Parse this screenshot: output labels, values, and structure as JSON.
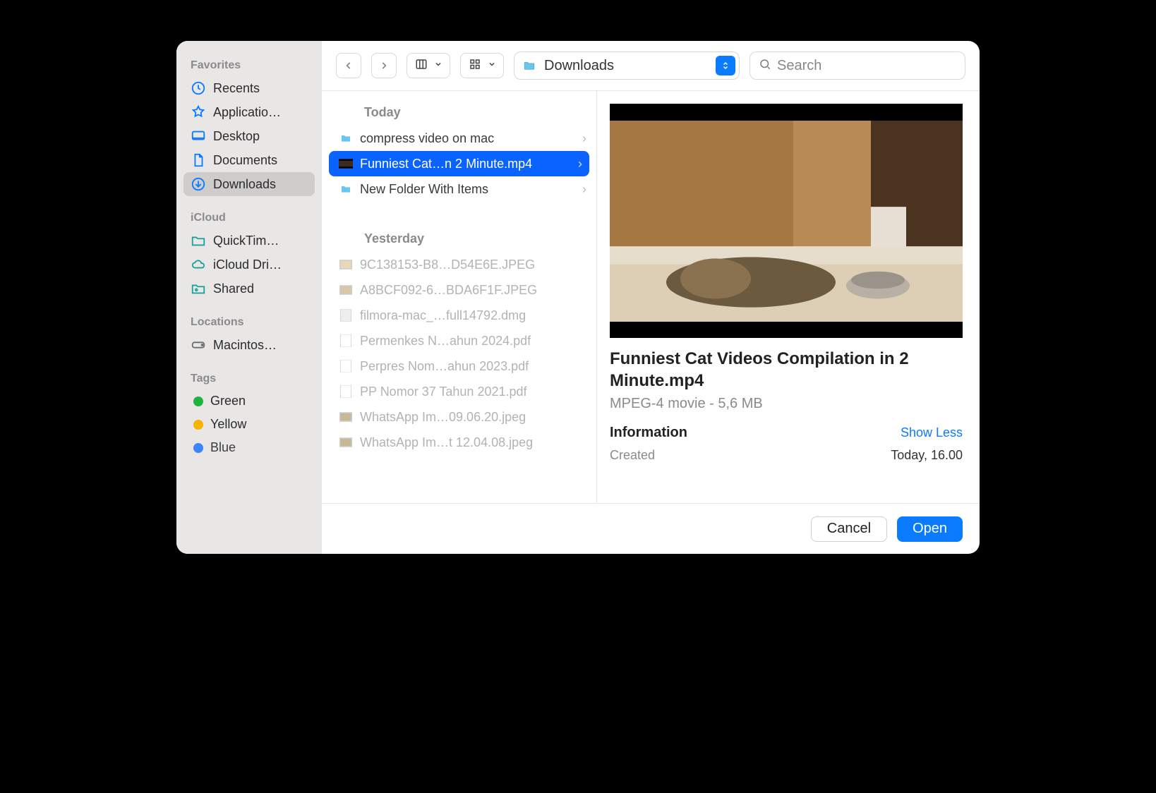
{
  "sidebar": {
    "groups": {
      "favorites": "Favorites",
      "icloud": "iCloud",
      "locations": "Locations",
      "tags": "Tags"
    },
    "favorites": [
      {
        "label": "Recents"
      },
      {
        "label": "Applicatio…"
      },
      {
        "label": "Desktop"
      },
      {
        "label": "Documents"
      },
      {
        "label": "Downloads"
      }
    ],
    "icloud": [
      {
        "label": "QuickTim…"
      },
      {
        "label": "iCloud Dri…"
      },
      {
        "label": "Shared"
      }
    ],
    "locations": [
      {
        "label": "Macintos…"
      }
    ],
    "tags": [
      {
        "label": "Green",
        "color": "#1fb141"
      },
      {
        "label": "Yellow",
        "color": "#f5b400"
      },
      {
        "label": "Blue",
        "color": "#2a7bf6"
      }
    ]
  },
  "toolbar": {
    "location": "Downloads",
    "search_placeholder": "Search"
  },
  "list": {
    "section_today": "Today",
    "section_yesterday": "Yesterday",
    "today": [
      {
        "name": "compress video on mac",
        "kind": "folder",
        "chev": true
      },
      {
        "name": "Funniest Cat…n 2 Minute.mp4",
        "kind": "video",
        "chev": true,
        "selected": true
      },
      {
        "name": "New Folder With Items",
        "kind": "folder",
        "chev": true
      }
    ],
    "yesterday": [
      {
        "name": "9C138153-B8…D54E6E.JPEG",
        "kind": "image"
      },
      {
        "name": "A8BCF092-6…BDA6F1F.JPEG",
        "kind": "image"
      },
      {
        "name": "filmora-mac_…full14792.dmg",
        "kind": "dmg"
      },
      {
        "name": "Permenkes N…ahun 2024.pdf",
        "kind": "pdf"
      },
      {
        "name": "Perpres Nom…ahun 2023.pdf",
        "kind": "pdf"
      },
      {
        "name": "PP Nomor 37 Tahun 2021.pdf",
        "kind": "pdf"
      },
      {
        "name": "WhatsApp Im…09.06.20.jpeg",
        "kind": "image"
      },
      {
        "name": "WhatsApp Im…t 12.04.08.jpeg",
        "kind": "image"
      }
    ]
  },
  "preview": {
    "title": "Funniest Cat Videos Compilation in 2 Minute.mp4",
    "subtitle": "MPEG-4 movie - 5,6 MB",
    "info_label": "Information",
    "show_less": "Show Less",
    "created_label": "Created",
    "created_value": "Today, 16.00"
  },
  "footer": {
    "cancel": "Cancel",
    "open": "Open"
  }
}
